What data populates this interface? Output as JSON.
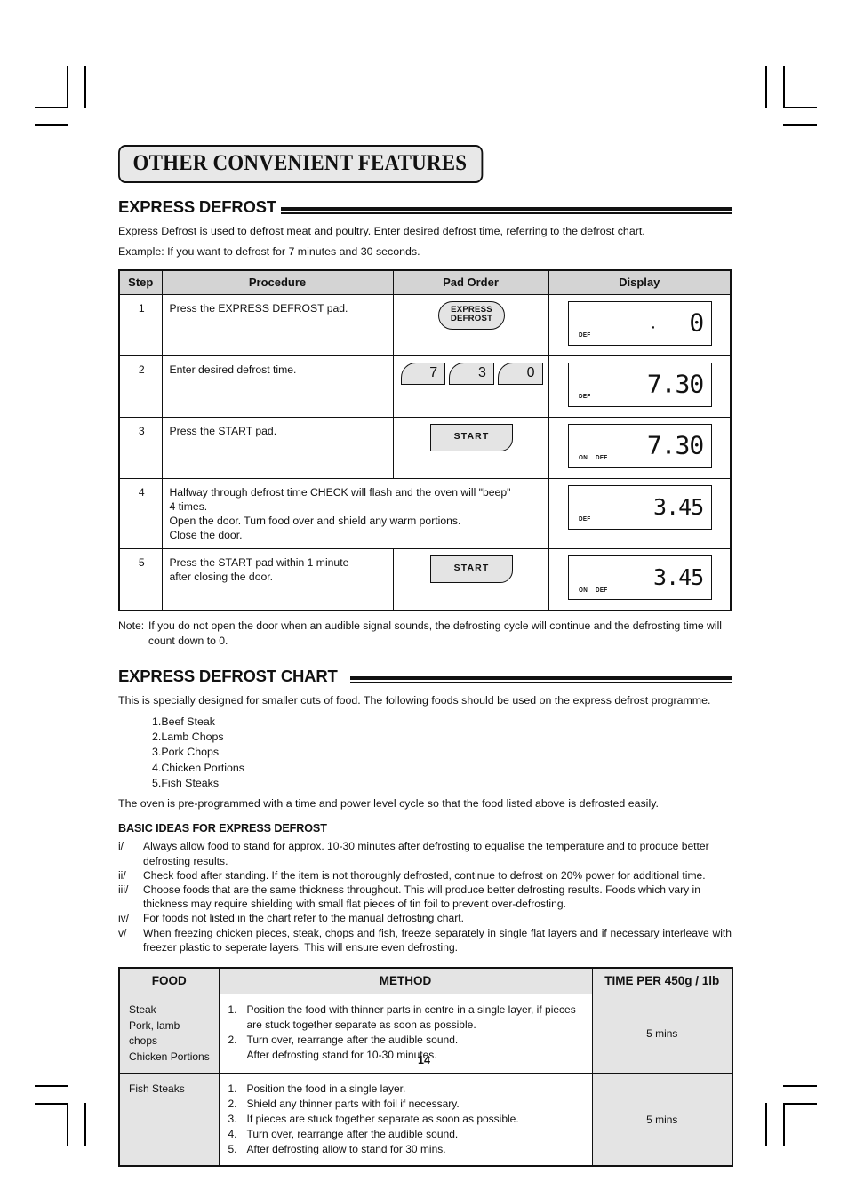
{
  "banner_title": "OTHER CONVENIENT FEATURES",
  "section1": {
    "heading": "EXPRESS DEFROST",
    "intro": "Express Defrost is used to defrost meat and poultry. Enter desired defrost time, referring to the defrost chart.",
    "example": "Example: If you want to defrost for 7 minutes and 30 seconds.",
    "table": {
      "headers": [
        "Step",
        "Procedure",
        "Pad Order",
        "Display"
      ],
      "rows": [
        {
          "step": "1",
          "procedure": "Press the EXPRESS DEFROST pad.",
          "pad_type": "pill",
          "pad_line1": "EXPRESS",
          "pad_line2": "DEFROST",
          "display_value": "0",
          "display_dot": "·",
          "annunciators": [
            "DEF"
          ]
        },
        {
          "step": "2",
          "procedure": "Enter desired defrost time.",
          "pad_type": "digits",
          "pad_digits": [
            "7",
            "3",
            "0"
          ],
          "display_value": "7.30",
          "annunciators": [
            "DEF"
          ]
        },
        {
          "step": "3",
          "procedure": "Press the START pad.",
          "pad_type": "start",
          "pad_label": "START",
          "display_value": "7.30",
          "annunciators": [
            "ON",
            "DEF"
          ]
        },
        {
          "step": "4",
          "procedure_lines": [
            "Halfway through defrost time CHECK will flash and the oven will \"beep\"",
            "4 times.",
            "Open the door. Turn food over and shield any warm portions.",
            "Close the door."
          ],
          "pad_type": "none",
          "display_value": "3.45",
          "annunciators": [
            "DEF"
          ]
        },
        {
          "step": "5",
          "procedure_lines": [
            "Press the START pad within 1 minute",
            "after closing the door."
          ],
          "pad_type": "start",
          "pad_label": "START",
          "display_value": "3.45",
          "annunciators": [
            "ON",
            "DEF"
          ]
        }
      ]
    },
    "note_label": "Note:",
    "note_text": "If you do not open the door when an audible signal sounds, the defrosting cycle will continue and the defrosting time will count down to 0."
  },
  "section2": {
    "heading": "EXPRESS DEFROST CHART",
    "intro": "This is specially designed for smaller cuts of food. The following foods should be used on the express defrost programme.",
    "foods": [
      "1.Beef Steak",
      "2.Lamb Chops",
      "3.Pork Chops",
      "4.Chicken Portions",
      "5.Fish Steaks"
    ],
    "outro": "The oven is pre-programmed with a time and power level cycle so that the food listed above is defrosted easily.",
    "subheading": "BASIC IDEAS FOR EXPRESS DEFROST",
    "ideas": [
      {
        "marker": "i/",
        "text": "Always allow food to stand for approx. 10-30 minutes after defrosting to equalise the temperature and to produce better defrosting results."
      },
      {
        "marker": "ii/",
        "text": "Check food after standing. If the item is not thoroughly defrosted, continue to defrost on 20% power for additional time."
      },
      {
        "marker": "iii/",
        "text": "Choose foods that are the same thickness throughout. This will produce better defrosting results. Foods which vary in thickness may require shielding with small flat pieces of tin foil to prevent over-defrosting."
      },
      {
        "marker": "iv/",
        "text": "For foods not listed in the chart refer to the manual defrosting chart."
      },
      {
        "marker": "v/",
        "text": "When freezing chicken pieces, steak, chops and fish, freeze separately in single flat layers and if necessary interleave with freezer plastic to seperate layers. This will ensure even defrosting."
      }
    ],
    "chart": {
      "headers": [
        "FOOD",
        "METHOD",
        "TIME PER 450g / 1lb"
      ],
      "rows": [
        {
          "food_lines": [
            "Steak",
            "Pork, lamb",
            "chops",
            "Chicken Portions"
          ],
          "steps": [
            {
              "n": "1.",
              "text": "Position the food with thinner parts in centre in a single layer, if pieces are stuck together separate as soon as possible."
            },
            {
              "n": "2.",
              "text": "Turn over, rearrange after the audible sound.",
              "sub": "After defrosting stand for 10-30 minutes."
            }
          ],
          "time": "5 mins"
        },
        {
          "food_lines": [
            "Fish Steaks"
          ],
          "steps": [
            {
              "n": "1.",
              "text": "Position the food in a single layer."
            },
            {
              "n": "2.",
              "text": "Shield any thinner parts with foil if necessary."
            },
            {
              "n": "3.",
              "text": "If pieces are stuck together separate as soon as possible."
            },
            {
              "n": "4.",
              "text": "Turn over, rearrange after the audible sound."
            },
            {
              "n": "5.",
              "text": "After defrosting allow to stand for 30 mins."
            }
          ],
          "time": "5 mins"
        }
      ]
    }
  },
  "page_number": "14"
}
